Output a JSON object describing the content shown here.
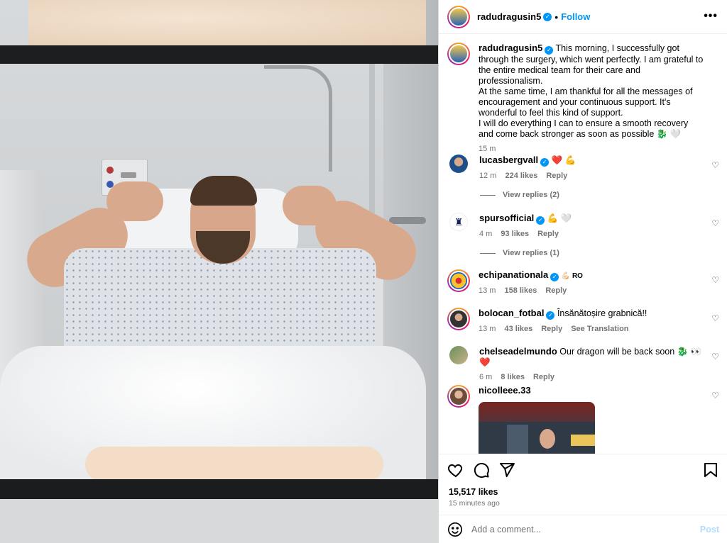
{
  "post_author": {
    "username": "radudragusin5",
    "follow_label": "Follow",
    "more_label": "•••"
  },
  "caption": {
    "username": "radudragusin5",
    "lines": [
      "This morning, I successfully got through the surgery, which went perfectly. I am grateful to the entire medical team for their care and professionalism.",
      "At the same time, I am thankful for all the messages of encouragement and your continuous support. It's wonderful to feel this kind of support.",
      "I will do everything I can to ensure a smooth recovery and come back stronger as soon as possible 🐉 🤍"
    ],
    "time": "15 m"
  },
  "comments": [
    {
      "username": "lucasbergvall",
      "verified": true,
      "text": "❤️ 💪",
      "time": "12 m",
      "likes": "224 likes",
      "reply": "Reply",
      "view_replies": "View replies (2)"
    },
    {
      "username": "spursofficial",
      "verified": true,
      "text": "💪 🤍",
      "time": "4 m",
      "likes": "93 likes",
      "reply": "Reply",
      "view_replies": "View replies (1)"
    },
    {
      "username": "echipanationala",
      "verified": true,
      "text": "💪🏻 RO",
      "time": "13 m",
      "likes": "158 likes",
      "reply": "Reply"
    },
    {
      "username": "bolocan_fotbal",
      "verified": true,
      "text": "Însănătoșire grabnică!!",
      "time": "13 m",
      "likes": "43 likes",
      "reply": "Reply",
      "translate": "See Translation"
    },
    {
      "username": "chelseadelmundo",
      "verified": false,
      "text": "Our dragon will be back soon 🐉 👀 ❤️",
      "time": "6 m",
      "likes": "8 likes",
      "reply": "Reply"
    },
    {
      "username": "nicolleee.33",
      "verified": false,
      "text": ""
    }
  ],
  "stats": {
    "likes": "15,517 likes",
    "time_ago": "15 minutes ago"
  },
  "add_comment": {
    "placeholder": "Add a comment...",
    "post_label": "Post"
  },
  "colors": {
    "accent": "#0095f6",
    "muted": "#737373",
    "post_disabled": "#b3dbff"
  },
  "icons": [
    "heart-icon",
    "comment-icon",
    "share-icon",
    "bookmark-icon",
    "emoji-icon",
    "more-icon",
    "verified-icon"
  ]
}
